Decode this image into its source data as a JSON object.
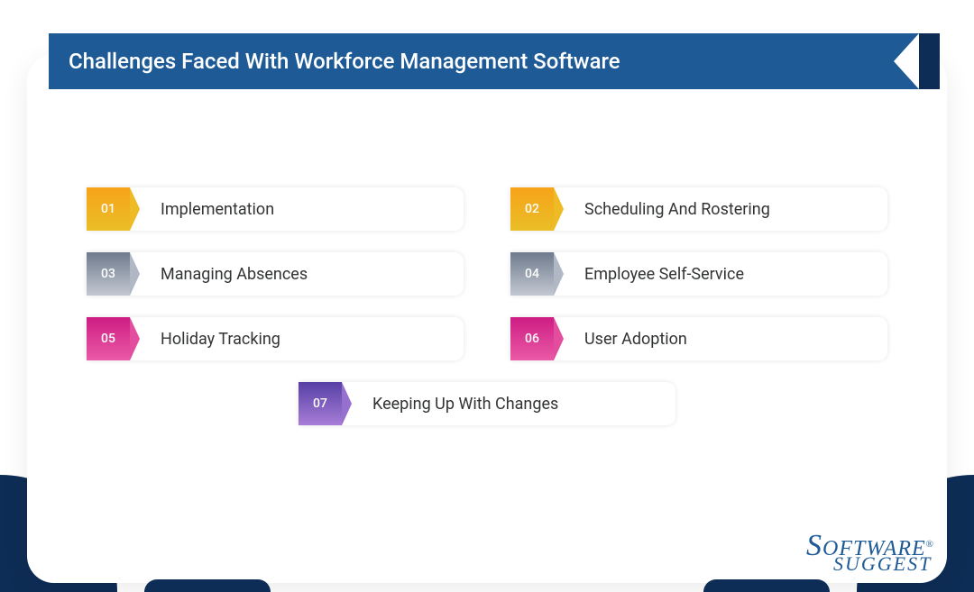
{
  "title": "Challenges Faced With Workforce Management Software",
  "items": [
    {
      "num": "01",
      "label": "Implementation",
      "colorClass": "badge-orange"
    },
    {
      "num": "02",
      "label": "Scheduling And Rostering",
      "colorClass": "badge-orange"
    },
    {
      "num": "03",
      "label": "Managing Absences",
      "colorClass": "badge-gray"
    },
    {
      "num": "04",
      "label": "Employee Self-Service",
      "colorClass": "badge-gray"
    },
    {
      "num": "05",
      "label": "Holiday Tracking",
      "colorClass": "badge-pink"
    },
    {
      "num": "06",
      "label": "User Adoption",
      "colorClass": "badge-pink"
    },
    {
      "num": "07",
      "label": "Keeping Up With Changes",
      "colorClass": "badge-purple"
    }
  ],
  "logo": {
    "line1a": "S",
    "line1b": "OFTWARE",
    "line2a": "S",
    "line2b": "UGGEST",
    "reg": "®"
  }
}
